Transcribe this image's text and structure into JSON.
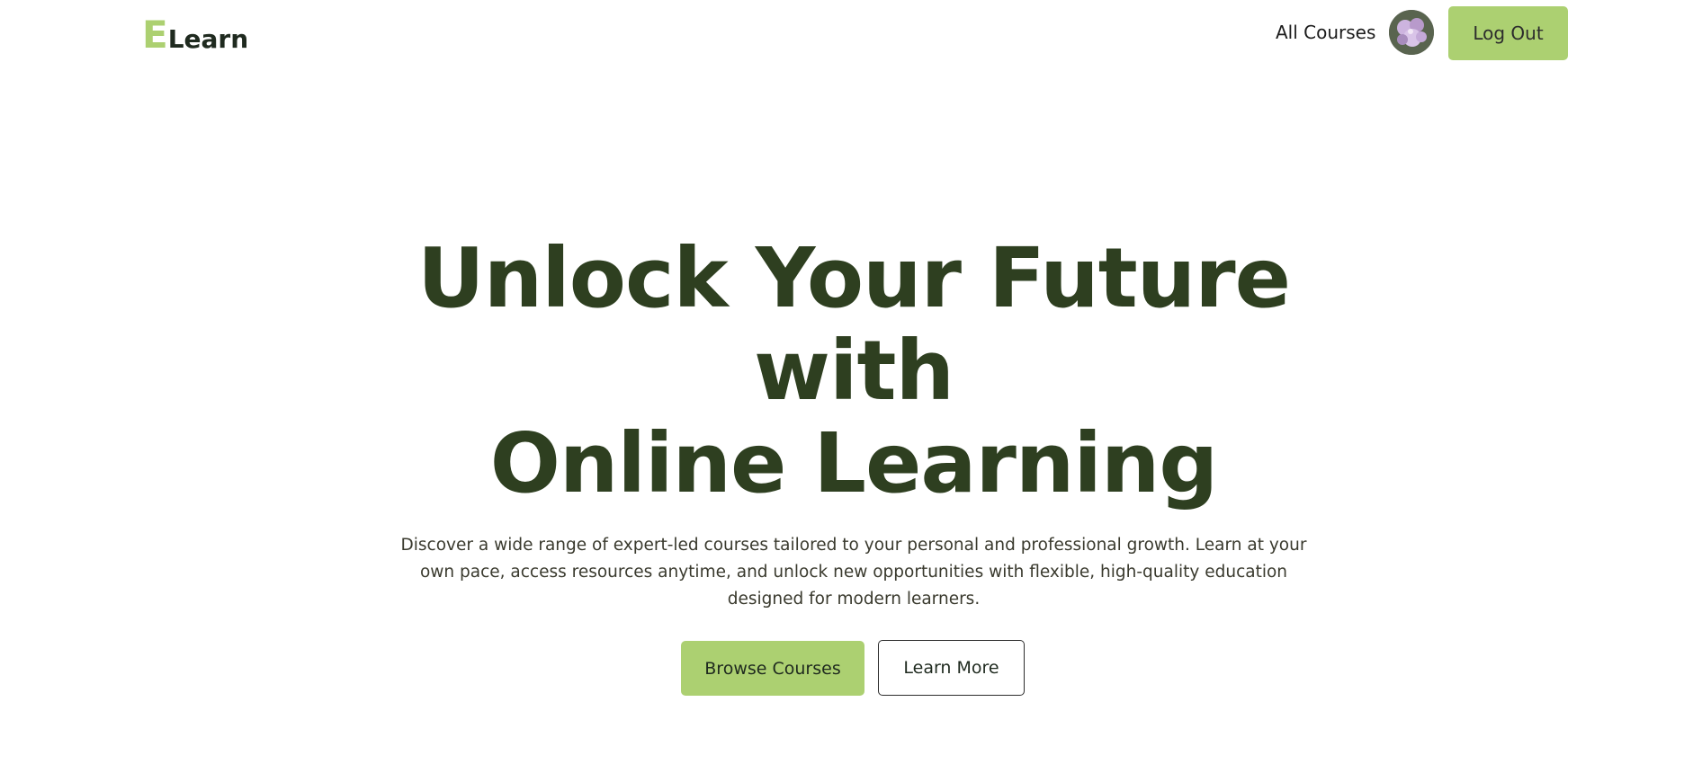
{
  "colors": {
    "accent": "#acd071",
    "heading": "#2e3f20",
    "text": "#3a3a2e"
  },
  "header": {
    "logo_letter": "E",
    "logo_rest": "Learn",
    "nav_all_courses": "All Courses",
    "avatar_icon": "user-avatar-flower-photo",
    "logout_label": "Log Out"
  },
  "hero": {
    "title_line1": "Unlock Your Future",
    "title_line2": "with",
    "title_line3": "Online Learning",
    "description": "Discover a wide range of expert-led courses tailored to your personal and professional growth. Learn at your own pace, access resources anytime, and unlock new opportunities with flexible, high-quality education designed for modern learners.",
    "primary_button": "Browse Courses",
    "secondary_button": "Learn More"
  }
}
